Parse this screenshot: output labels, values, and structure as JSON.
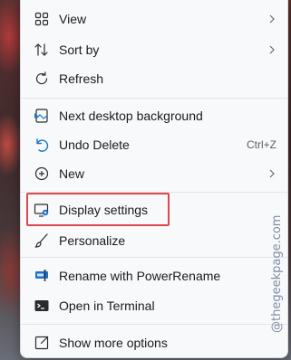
{
  "menu": {
    "items": [
      {
        "label": "View",
        "submenu": true,
        "icon": "grid-icon"
      },
      {
        "label": "Sort by",
        "submenu": true,
        "icon": "sort-icon"
      },
      {
        "label": "Refresh",
        "icon": "refresh-icon"
      },
      {
        "label": "Next desktop background",
        "icon": "next-background-icon"
      },
      {
        "label": "Undo Delete",
        "shortcut": "Ctrl+Z",
        "icon": "undo-icon"
      },
      {
        "label": "New",
        "submenu": true,
        "icon": "plus-circle-icon"
      },
      {
        "label": "Display settings",
        "icon": "display-settings-icon",
        "highlighted": true
      },
      {
        "label": "Personalize",
        "icon": "brush-icon"
      },
      {
        "label": "Rename with PowerRename",
        "icon": "power-rename-icon"
      },
      {
        "label": "Open in Terminal",
        "icon": "terminal-icon"
      },
      {
        "label": "Show more options",
        "icon": "show-more-icon"
      }
    ]
  },
  "watermark": "@thegeekpage.com",
  "colors": {
    "highlight_border": "#e0474c",
    "accent_blue": "#1a73c8",
    "menu_bg": "#f8f9fb"
  }
}
